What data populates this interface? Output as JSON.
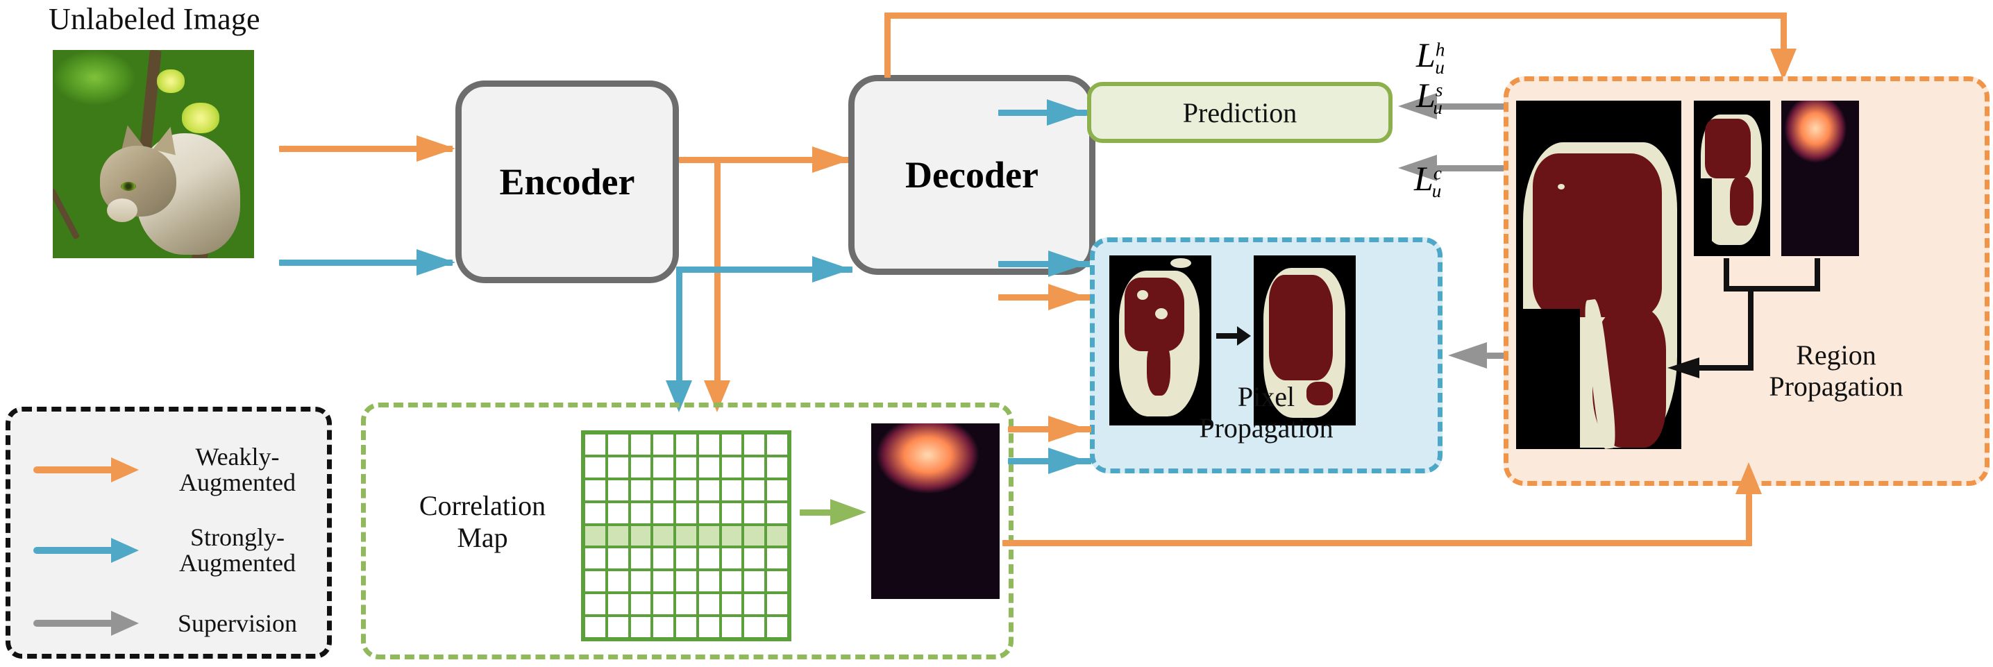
{
  "title": "Unlabeled Image",
  "blocks": {
    "encoder": "Encoder",
    "decoder": "Decoder",
    "prediction": "Prediction"
  },
  "panels": {
    "correlation_map": "Correlation\nMap",
    "correlation_map_line1": "Correlation",
    "correlation_map_line2": "Map",
    "pixel_propagation_line1": "Pixel",
    "pixel_propagation_line2": "Propagation",
    "region_propagation_line1": "Region",
    "region_propagation_line2": "Propagation"
  },
  "losses": {
    "hard": {
      "symbol": "L",
      "sup": "h",
      "sub": "u"
    },
    "soft": {
      "symbol": "L",
      "sup": "s",
      "sub": "u"
    },
    "corr": {
      "symbol": "L",
      "sup": "c",
      "sub": "u"
    }
  },
  "legend": {
    "items": [
      {
        "label_line1": "Weakly-",
        "label_line2": "Augmented",
        "color": "#f0984f"
      },
      {
        "label_line1": "Strongly-",
        "label_line2": "Augmented",
        "color": "#4fa8c6"
      },
      {
        "label_line1": "Supervision",
        "label_line2": "",
        "color": "#949494"
      }
    ]
  },
  "colors": {
    "weak_orange": "#f0984f",
    "strong_blue": "#4fa8c6",
    "supervision_gray": "#949494",
    "block_border": "#6d6d6d",
    "block_fill": "#f2f2f2",
    "prediction_border": "#8cb14c",
    "prediction_fill": "#e9efd9",
    "correlation_green": "#8fb95a",
    "grid_green": "#5ba03a",
    "grid_highlight": "#cfe3b4",
    "pixel_panel_border": "#4da8c8",
    "pixel_panel_fill": "#d7ebf5",
    "region_panel_border": "#f09448",
    "region_panel_fill": "#fbe9dc",
    "mask_maroon": "#6b1418",
    "mask_cream": "#e8e6cc",
    "mask_background": "#000000"
  },
  "correlation_grid": {
    "columns": 9,
    "rows": 9,
    "highlighted_row": 5
  }
}
